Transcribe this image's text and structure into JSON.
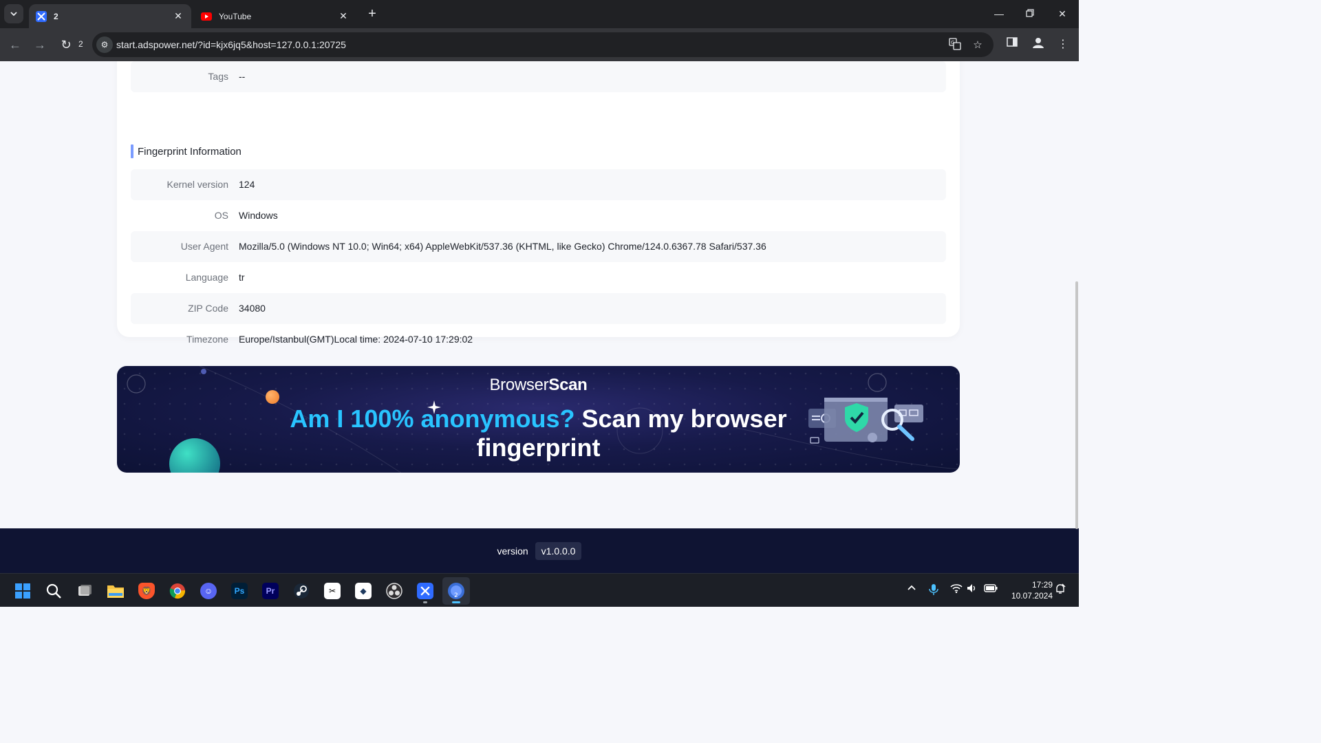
{
  "browser": {
    "tabs": [
      {
        "title": "2",
        "favicon": "adspower-icon",
        "active": true
      },
      {
        "title": "YouTube",
        "favicon": "youtube-icon",
        "active": false
      }
    ],
    "reload_count": "2",
    "url": "start.adspower.net/?id=kjx6jq5&host=127.0.0.1:20725"
  },
  "profile": {
    "tags_label": "Tags",
    "tags_value": "--",
    "section_title": "Fingerprint Information",
    "rows": [
      {
        "label": "Kernel version",
        "value": "124"
      },
      {
        "label": "OS",
        "value": "Windows"
      },
      {
        "label": "User Agent",
        "value": "Mozilla/5.0 (Windows NT 10.0; Win64; x64) AppleWebKit/537.36 (KHTML, like Gecko) Chrome/124.0.6367.78 Safari/537.36"
      },
      {
        "label": "Language",
        "value": "tr"
      },
      {
        "label": "ZIP Code",
        "value": "34080"
      },
      {
        "label": "Timezone",
        "value": "Europe/Istanbul(GMT)Local time: 2024-07-10 17:29:02"
      }
    ]
  },
  "banner": {
    "brand_light": "Browser",
    "brand_bold": "Scan",
    "headline_accent": "Am I 100% anonymous?",
    "headline_rest": " Scan my browser fingerprint"
  },
  "footer": {
    "version_label": "version",
    "version_value": "v1.0.0.0"
  },
  "taskbar": {
    "apps": [
      "start-icon",
      "search-icon",
      "task-view-icon",
      "file-explorer-icon",
      "brave-icon",
      "chrome-icon",
      "discord-icon",
      "photoshop-icon",
      "premiere-icon",
      "steam-icon",
      "capcut-icon",
      "app-icon",
      "obs-icon",
      "adspower-icon",
      "adspower-browser-icon"
    ],
    "ps_label": "Ps",
    "pr_label": "Pr",
    "time": "17:29",
    "date": "10.07.2024"
  },
  "colors": {
    "accent_blue": "#29c4ff",
    "section_bar": "#7b9cff",
    "footer_bg": "#0f1433"
  }
}
